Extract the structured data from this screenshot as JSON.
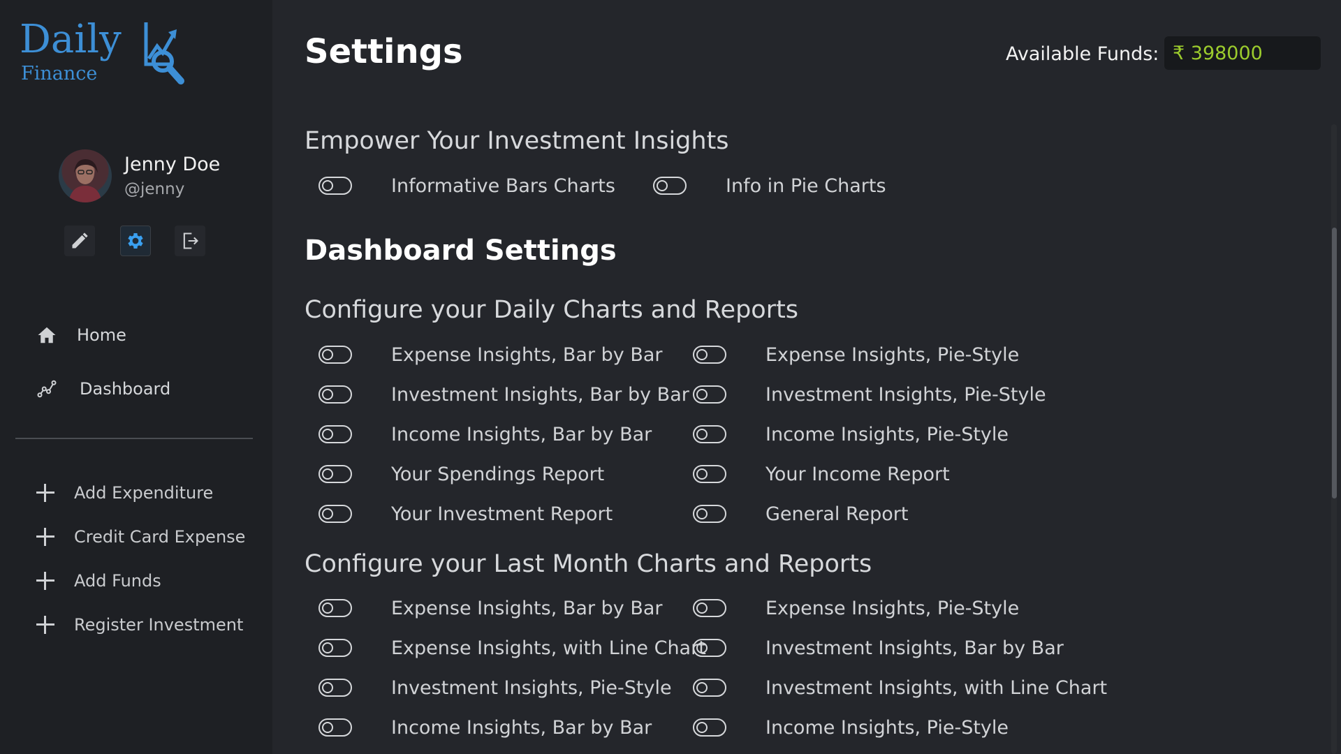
{
  "logo": {
    "title": "Daily",
    "subtitle": "Finance"
  },
  "colors": {
    "accent": "#3d8fd6",
    "funds": "#9ccc2d",
    "background": "#24262b",
    "sidebar": "#1e2024"
  },
  "user": {
    "name": "Jenny Doe",
    "handle": "@jenny"
  },
  "profile_actions": [
    {
      "icon": "pencil-icon"
    },
    {
      "icon": "gear-icon",
      "active": true
    },
    {
      "icon": "logout-icon"
    }
  ],
  "nav": [
    {
      "label": "Home",
      "icon": "home-icon"
    },
    {
      "label": "Dashboard",
      "icon": "chart-icon"
    }
  ],
  "actions": [
    {
      "label": "Add Expenditure",
      "icon": "plus-icon"
    },
    {
      "label": "Credit Card Expense",
      "icon": "plus-icon"
    },
    {
      "label": "Add Funds",
      "icon": "plus-icon"
    },
    {
      "label": "Register Investment",
      "icon": "plus-icon"
    }
  ],
  "header": {
    "title": "Settings",
    "funds_label": "Available Funds:",
    "funds_value": "₹ 398000"
  },
  "insights": {
    "heading": "Empower Your Investment Insights",
    "toggles": [
      {
        "label": "Informative Bars Charts",
        "on": false
      },
      {
        "label": "Info in Pie Charts",
        "on": false
      }
    ]
  },
  "dashboard": {
    "heading": "Dashboard Settings",
    "daily": {
      "heading": "Configure your Daily Charts and Reports",
      "left": [
        {
          "label": "Expense Insights, Bar by Bar",
          "on": false
        },
        {
          "label": "Investment Insights, Bar by Bar",
          "on": false
        },
        {
          "label": "Income Insights, Bar by Bar",
          "on": false
        },
        {
          "label": "Your Spendings Report",
          "on": false
        },
        {
          "label": "Your Investment Report",
          "on": false
        }
      ],
      "right": [
        {
          "label": "Expense Insights, Pie-Style",
          "on": false
        },
        {
          "label": "Investment Insights, Pie-Style",
          "on": false
        },
        {
          "label": "Income Insights, Pie-Style",
          "on": false
        },
        {
          "label": "Your Income Report",
          "on": false
        },
        {
          "label": "General Report",
          "on": false
        }
      ]
    },
    "monthly": {
      "heading": "Configure your Last Month Charts and Reports",
      "left": [
        {
          "label": "Expense Insights, Bar by Bar",
          "on": false
        },
        {
          "label": "Expense Insights, with Line Chart",
          "on": false
        },
        {
          "label": "Investment Insights, Pie-Style",
          "on": false
        },
        {
          "label": "Income Insights, Bar by Bar",
          "on": false
        }
      ],
      "right": [
        {
          "label": "Expense Insights, Pie-Style",
          "on": false
        },
        {
          "label": "Investment Insights, Bar by Bar",
          "on": false
        },
        {
          "label": "Investment Insights, with Line Chart",
          "on": false
        },
        {
          "label": "Income Insights, Pie-Style",
          "on": false
        }
      ]
    }
  }
}
